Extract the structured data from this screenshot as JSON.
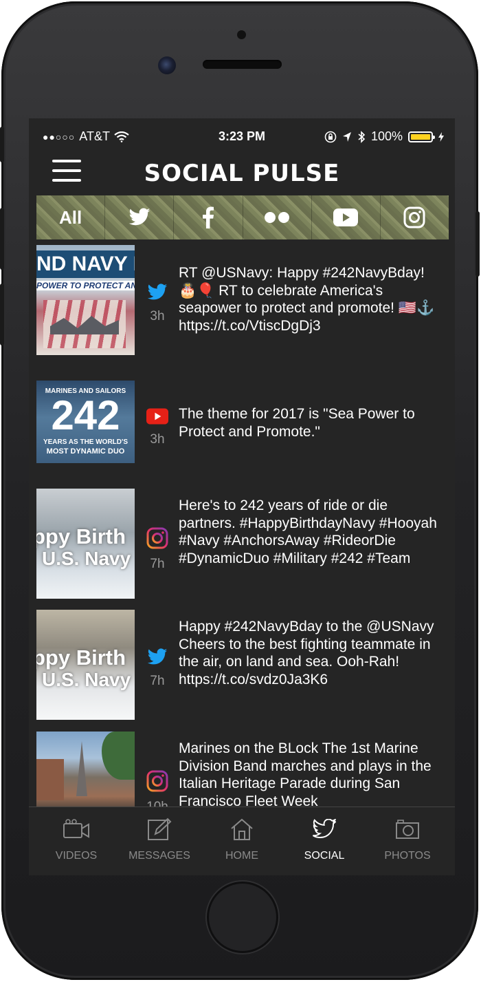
{
  "status_bar": {
    "signal": "●●○○○",
    "carrier": "AT&T",
    "time": "3:23 PM",
    "battery": "100%"
  },
  "header": {
    "title": "SOCIAL PULSE"
  },
  "filters": [
    {
      "label": "All",
      "icon": "all"
    },
    {
      "label": "",
      "icon": "twitter-icon"
    },
    {
      "label": "",
      "icon": "facebook-icon"
    },
    {
      "label": "",
      "icon": "flickr-icon"
    },
    {
      "label": "",
      "icon": "youtube-icon"
    },
    {
      "label": "",
      "icon": "instagram-icon"
    }
  ],
  "posts": [
    {
      "source": "twitter",
      "ago": "3h",
      "text": "RT @USNavy: Happy #242NavyBday! 🎂🎈 RT to celebrate America's seapower to protect and promote! 🇺🇸⚓ https://t.co/VtiscDgDj3",
      "thumb_text": [
        "ND NAVY BIR",
        "POWER TO PROTECT AND PROM"
      ]
    },
    {
      "source": "youtube",
      "ago": "3h",
      "text": "The theme for 2017 is \"Sea Power to Protect and Promote.\"",
      "thumb_text": [
        "MARINES AND SAILORS",
        "242",
        "YEARS AS THE WORLD'S",
        "MOST DYNAMIC DUO"
      ]
    },
    {
      "source": "instagram",
      "ago": "7h",
      "text": "Here's to 242 years of ride or die partners. #HappyBirthdayNavy #Hooyah #Navy #AnchorsAway #RideorDie #DynamicDuo #Military #242 #Team",
      "thumb_text": [
        "ppy Birth",
        "U.S. Navy"
      ]
    },
    {
      "source": "twitter",
      "ago": "7h",
      "text": "Happy #242NavyBday to the @USNavy  Cheers to the best fighting teammate in the air, on land and sea. Ooh-Rah! https://t.co/svdz0Ja3K6",
      "thumb_text": [
        "ppy Birth",
        "U.S. Navy"
      ]
    },
    {
      "source": "instagram",
      "ago": "10h",
      "text": "Marines on the BLock The 1st Marine Division Band marches and plays in the Italian Heritage Parade during San Francisco Fleet Week",
      "thumb_text": []
    }
  ],
  "tabs": [
    {
      "label": "VIDEOS",
      "icon": "video-camera-icon",
      "active": false
    },
    {
      "label": "MESSAGES",
      "icon": "compose-icon",
      "active": false
    },
    {
      "label": "HOME",
      "icon": "home-icon",
      "active": false
    },
    {
      "label": "SOCIAL",
      "icon": "twitter-bird-icon",
      "active": true
    },
    {
      "label": "PHOTOS",
      "icon": "camera-icon",
      "active": false
    }
  ],
  "colors": {
    "twitter": "#1da1f2",
    "youtube": "#e62117",
    "battery": "#ffd21f",
    "screen_bg": "#252525"
  }
}
